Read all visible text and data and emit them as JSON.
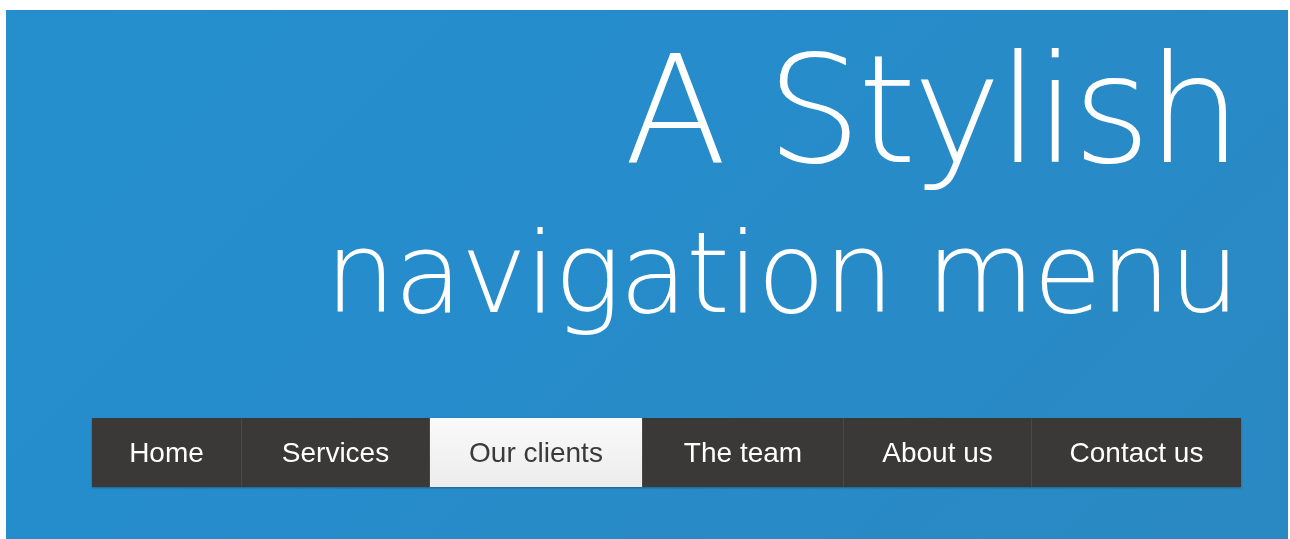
{
  "heading": {
    "line_1": "A Stylish",
    "line_2": "navigation menu"
  },
  "menu": [
    {
      "label": "Home",
      "selected": false
    },
    {
      "label": "Services",
      "selected": false
    },
    {
      "label": "Our clients",
      "selected": true
    },
    {
      "label": "The team",
      "selected": false
    },
    {
      "label": "About us",
      "selected": false
    },
    {
      "label": "Contact us",
      "selected": false
    }
  ]
}
